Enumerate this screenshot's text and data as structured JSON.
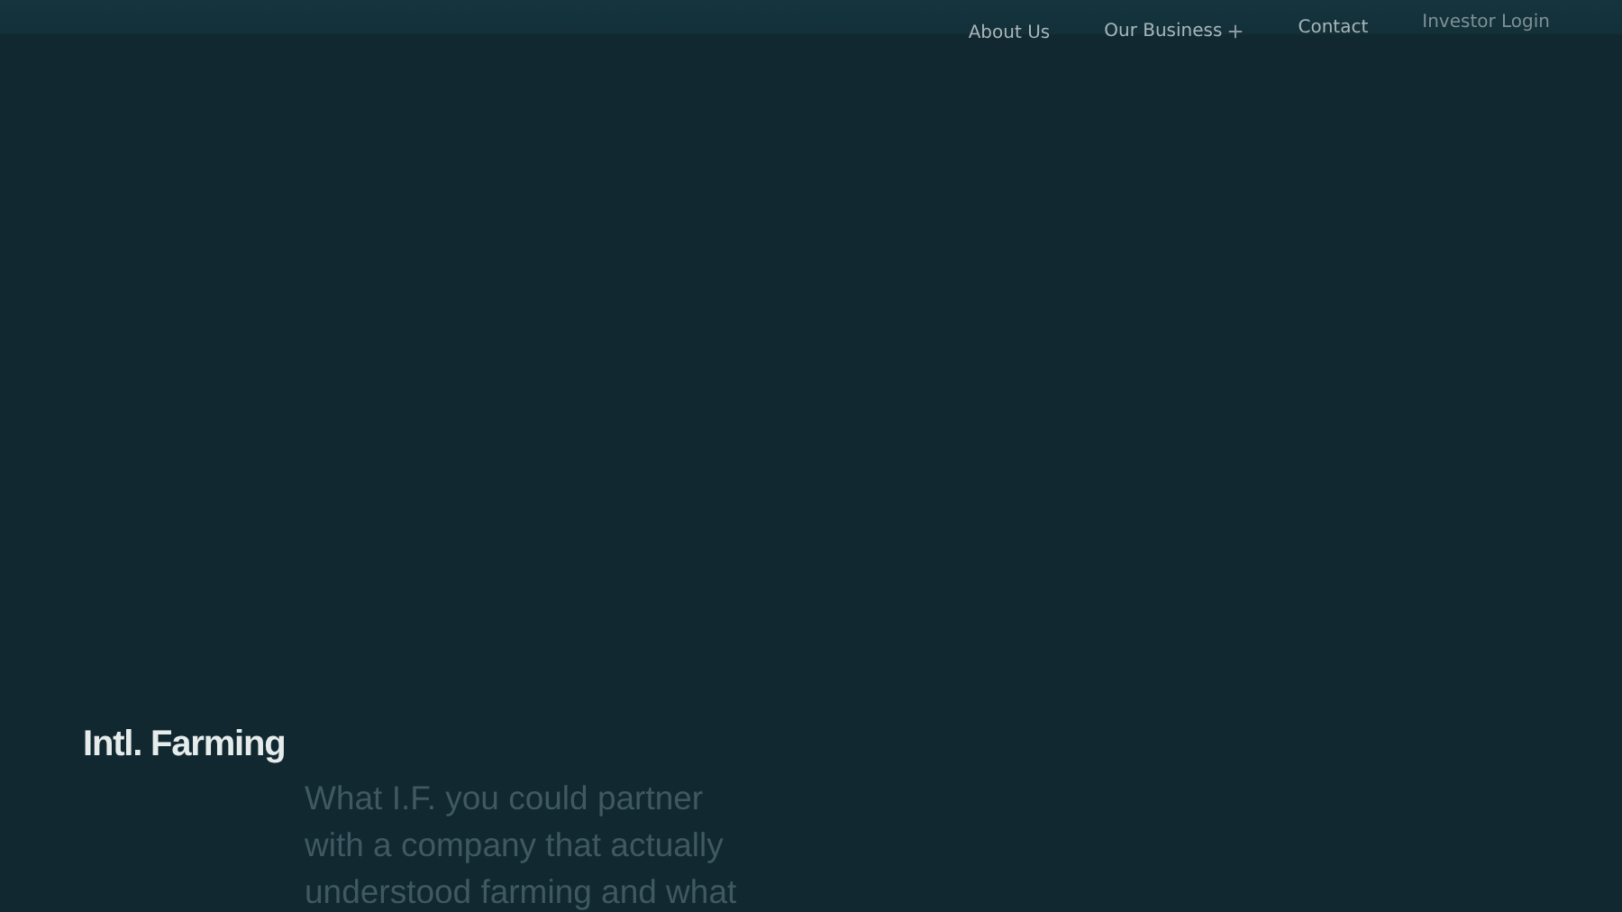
{
  "nav": {
    "links": [
      {
        "label": "About Us",
        "has_submenu": false
      },
      {
        "label": "Our Business",
        "has_submenu": true
      },
      {
        "label": "Contact",
        "has_submenu": false
      },
      {
        "label": "Investor Login",
        "has_submenu": false
      }
    ]
  },
  "hero": {
    "brand": "Intl. Farming",
    "intro_lines": [
      "What I.F. you could partner",
      "with a company that actually",
      "understood farming and what"
    ]
  }
}
